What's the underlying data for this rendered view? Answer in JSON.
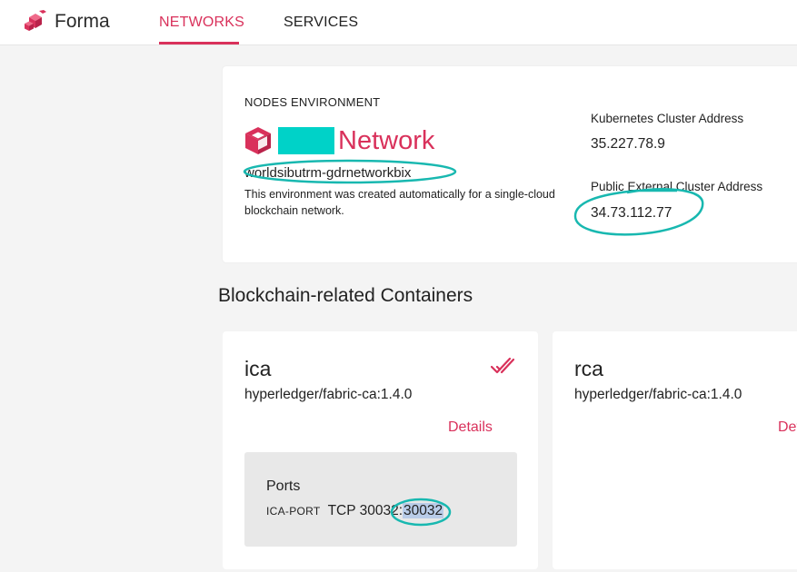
{
  "brand": {
    "name": "Forma",
    "color": "#d9315b"
  },
  "nav": {
    "tabs": [
      {
        "label": "NETWORKS",
        "active": true
      },
      {
        "label": "SERVICES",
        "active": false
      }
    ]
  },
  "environment": {
    "section_label": "NODES ENVIRONMENT",
    "icon": "cube-icon",
    "name_suffix": "Network",
    "id": "worldsibutrm-gdrnetworkbix",
    "description": "This environment was created automatically for a single-cloud blockchain network.",
    "kubernetes": {
      "label": "Kubernetes Cluster Address",
      "value": "35.227.78.9"
    },
    "public": {
      "label": "Public External Cluster Address",
      "value": "34.73.112.77"
    }
  },
  "containers_section": {
    "title": "Blockchain-related Containers"
  },
  "containers": [
    {
      "name": "ica",
      "image": "hyperledger/fabric-ca:1.4.0",
      "details_label": "Details",
      "status_icon": "double-check-icon",
      "ports_title": "Ports",
      "port": {
        "name": "ICA-PORT",
        "protocol": "TCP",
        "container_port": "30032",
        "separator": ":",
        "host_port": "30032"
      }
    },
    {
      "name": "rca",
      "image": "hyperledger/fabric-ca:1.4.0",
      "details_label": "Details"
    }
  ],
  "colors": {
    "accent": "#d9315b",
    "redaction": "#00d2c8",
    "annotation": "#18b8b0"
  }
}
